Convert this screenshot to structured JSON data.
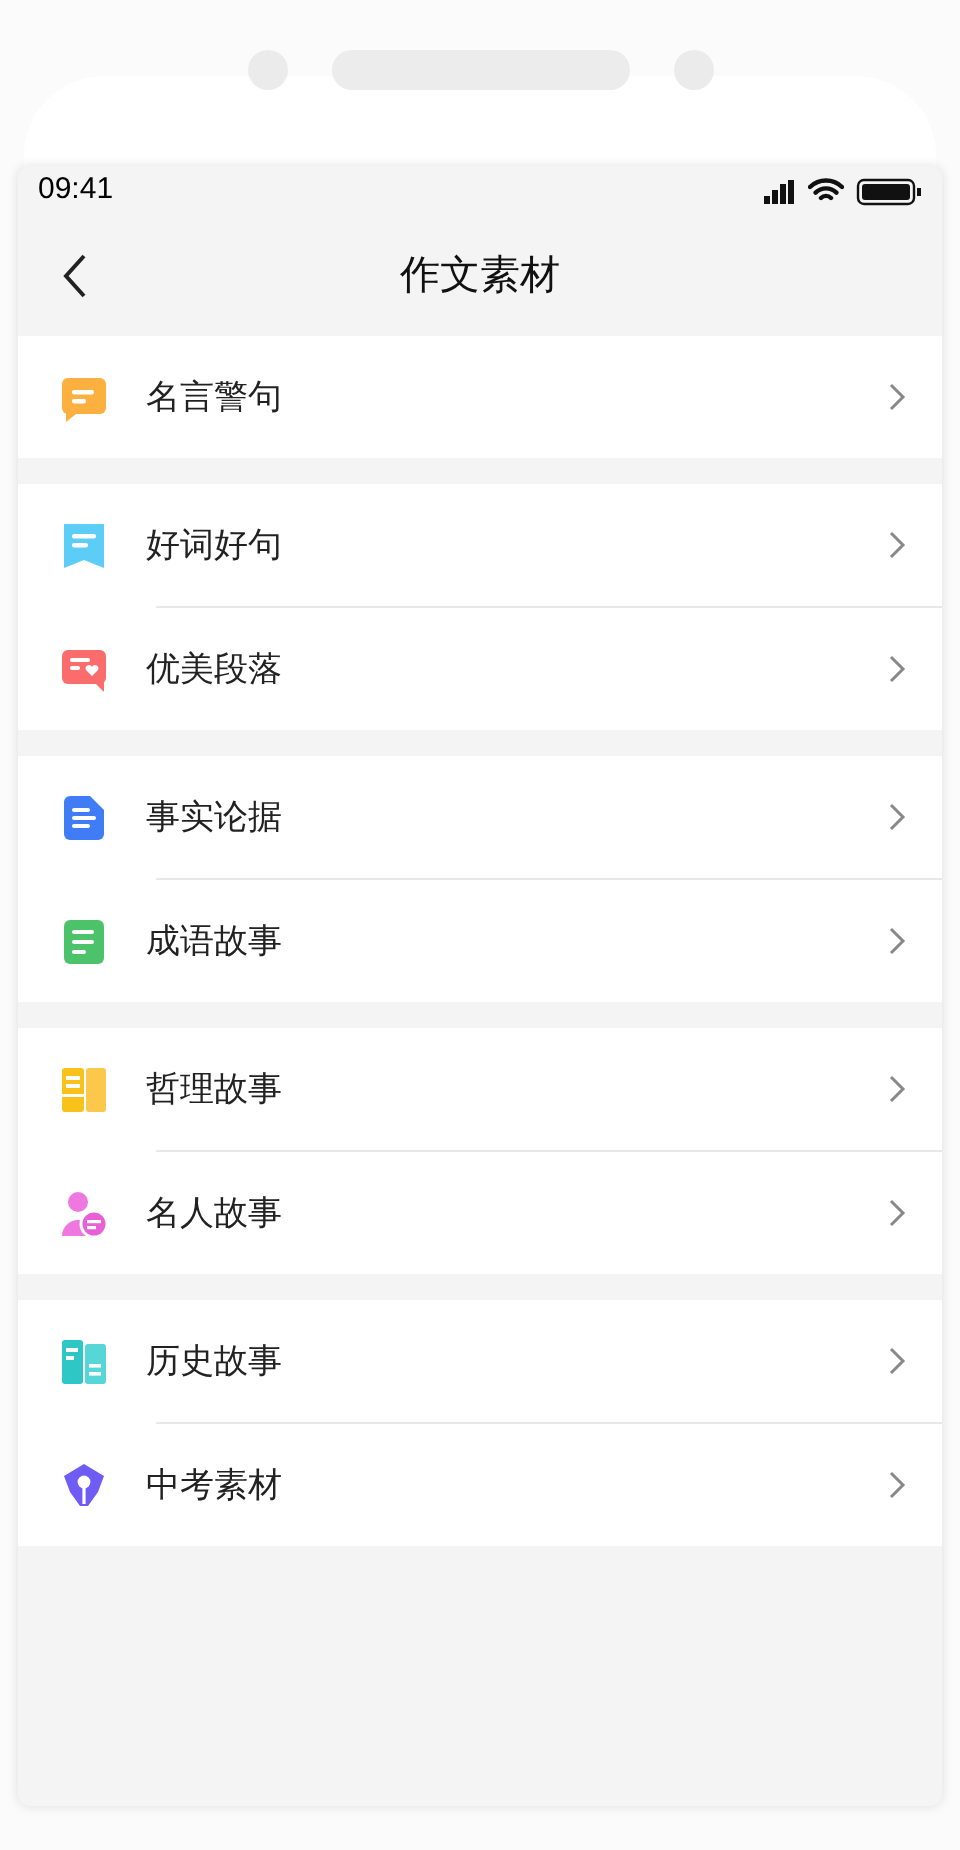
{
  "status_bar": {
    "time": "09:41"
  },
  "nav_bar": {
    "title": "作文素材"
  },
  "groups": [
    {
      "items": [
        {
          "label": "名言警句",
          "kind": "chat"
        }
      ]
    },
    {
      "items": [
        {
          "label": "好词好句",
          "kind": "bookmark"
        },
        {
          "label": "优美段落",
          "kind": "heart-chat"
        }
      ]
    },
    {
      "items": [
        {
          "label": "事实论据",
          "kind": "blue-doc"
        },
        {
          "label": "成语故事",
          "kind": "green-doc"
        }
      ]
    },
    {
      "items": [
        {
          "label": "哲理故事",
          "kind": "panels"
        },
        {
          "label": "名人故事",
          "kind": "person"
        }
      ]
    },
    {
      "items": [
        {
          "label": "历史故事",
          "kind": "book"
        },
        {
          "label": "中考素材",
          "kind": "pen"
        }
      ]
    }
  ]
}
